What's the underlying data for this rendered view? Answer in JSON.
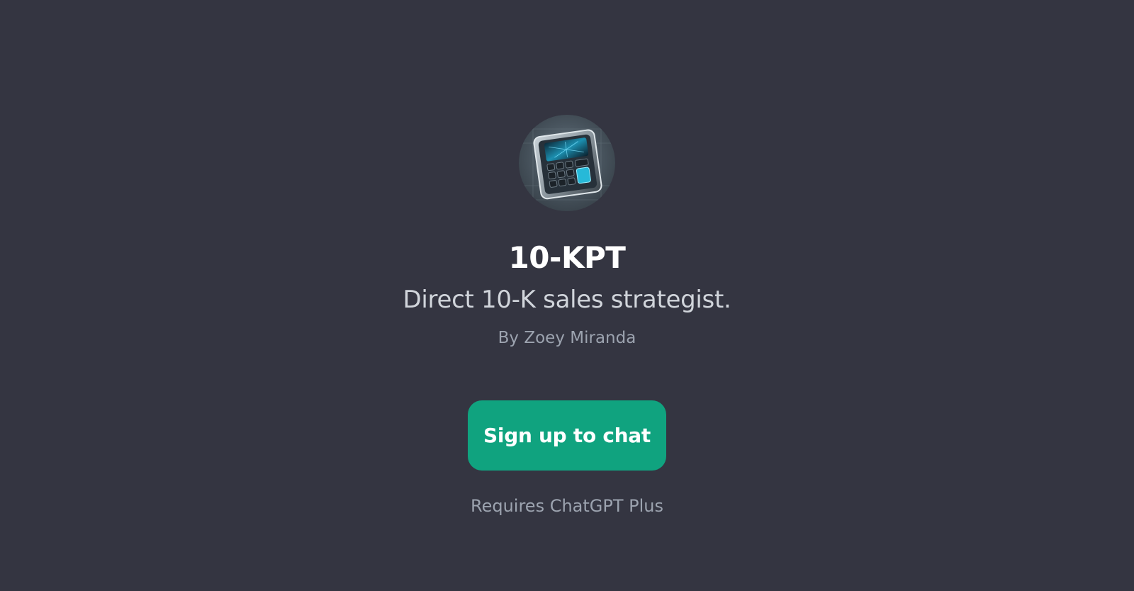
{
  "gpt": {
    "name": "10-KPT",
    "description": "Direct 10-K sales strategist.",
    "author": "By Zoey Miranda",
    "avatar_icon": "calculator-icon"
  },
  "actions": {
    "signup_label": "Sign up to chat",
    "requirement_note": "Requires ChatGPT Plus"
  },
  "colors": {
    "background": "#343541",
    "button": "#10a37f",
    "title": "#ffffff",
    "subtitle": "#d1d5db",
    "muted": "#9ca3af"
  }
}
